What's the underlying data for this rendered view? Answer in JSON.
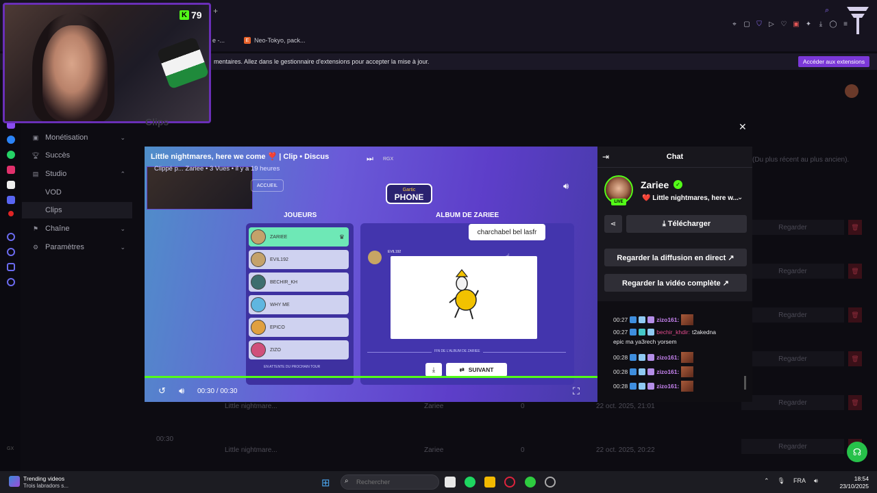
{
  "browser": {
    "tabs": [
      {
        "label": "e -...",
        "icon": "page-icon"
      },
      {
        "label": "Neo-Tokyo, pack...",
        "icon": "e-icon",
        "favicon_letter": "E"
      }
    ],
    "extension_notice": "mentaires. Allez dans le gestionnaire d'extensions pour accepter la mise à jour.",
    "extension_button": "Accéder aux extensions",
    "new_tab": "+"
  },
  "webcam": {
    "k_count": "79",
    "k_letter": "K"
  },
  "sidebar": {
    "items": [
      {
        "label": "Monétisation",
        "icon": "money-icon",
        "chevron": "⌄"
      },
      {
        "label": "Succès",
        "icon": "trophy-icon"
      },
      {
        "label": "Studio",
        "icon": "studio-icon",
        "chevron": "⌃"
      },
      {
        "label": "VOD"
      },
      {
        "label": "Clips"
      },
      {
        "label": "Chaîne",
        "icon": "channel-icon",
        "chevron": "⌄"
      },
      {
        "label": "Paramètres",
        "icon": "gear-icon",
        "chevron": "⌄"
      }
    ]
  },
  "page": {
    "title": "Clips",
    "sort_label": "(Du plus récent au plus ancien).",
    "row_action": "Regarder",
    "rows": [
      {
        "title": "Little nightmare...",
        "user": "Zariee",
        "views": "0",
        "date": "22 oct. 2025, 21:01",
        "duration": ""
      },
      {
        "title": "Little nightmare...",
        "user": "Zariee",
        "views": "0",
        "date": "22 oct. 2025, 20:22",
        "duration": "00:30"
      }
    ],
    "gx": "GX"
  },
  "video": {
    "title": "Little nightmares, here we come ❣️ | Clip • Discus",
    "subtitle": "Clippé p... Zariee • 3 Vues • il y a 19 heures",
    "rgx": "RGX",
    "time": "00:30 / 00:30",
    "progress_fraction": 1.0,
    "game": {
      "home_button": "ACCUEIL",
      "players_heading": "JOUEURS",
      "album_heading": "ALBUM DE ZARIEE",
      "players": [
        "ZARIEE",
        "EVIL192",
        "BECHIR_KH",
        "WHY ME",
        "EPICO",
        "ZIZO"
      ],
      "awaiting": "EN ATTENTE DU PROCHAIN TOUR",
      "bubble_text": "charchabel bel lasfr",
      "drawing_author": "EVIL192",
      "album_end": "FIN DE L'ALBUM DE ZARIEE",
      "next_button": "SUIVANT",
      "logo_line1": "Gartic",
      "logo_line2": "PHONE"
    }
  },
  "chat": {
    "title": "Chat",
    "streamer": "Zariee",
    "live": "LIVE",
    "stream_title": "❤️ Little nightmares, here w...",
    "download": "Télécharger",
    "watch_live": "Regarder la diffusion en direct",
    "watch_full": "Regarder la vidéo complète",
    "messages": [
      {
        "time": "00:27",
        "user": "zizo161:",
        "text": "",
        "style": "u1"
      },
      {
        "time": "00:27",
        "user": "bechir_khdir:",
        "text": "t2akedna",
        "style": "u2",
        "cont": "epic ma ya3rech yorsem"
      },
      {
        "time": "00:28",
        "user": "zizo161:",
        "text": "",
        "style": "u1"
      },
      {
        "time": "00:28",
        "user": "zizo161:",
        "text": "",
        "style": "u1"
      },
      {
        "time": "00:28",
        "user": "zizo161:",
        "text": "",
        "style": "u1"
      }
    ]
  },
  "taskbar": {
    "trend_title": "Trending videos",
    "trend_sub": "Trois labradors s...",
    "search_placeholder": "Rechercher",
    "lang": "FRA",
    "time": "18:54",
    "date": "23/10/2025"
  },
  "colors": {
    "accent": "#53fc18",
    "purple": "#7b38d8",
    "danger": "#3a1018"
  }
}
